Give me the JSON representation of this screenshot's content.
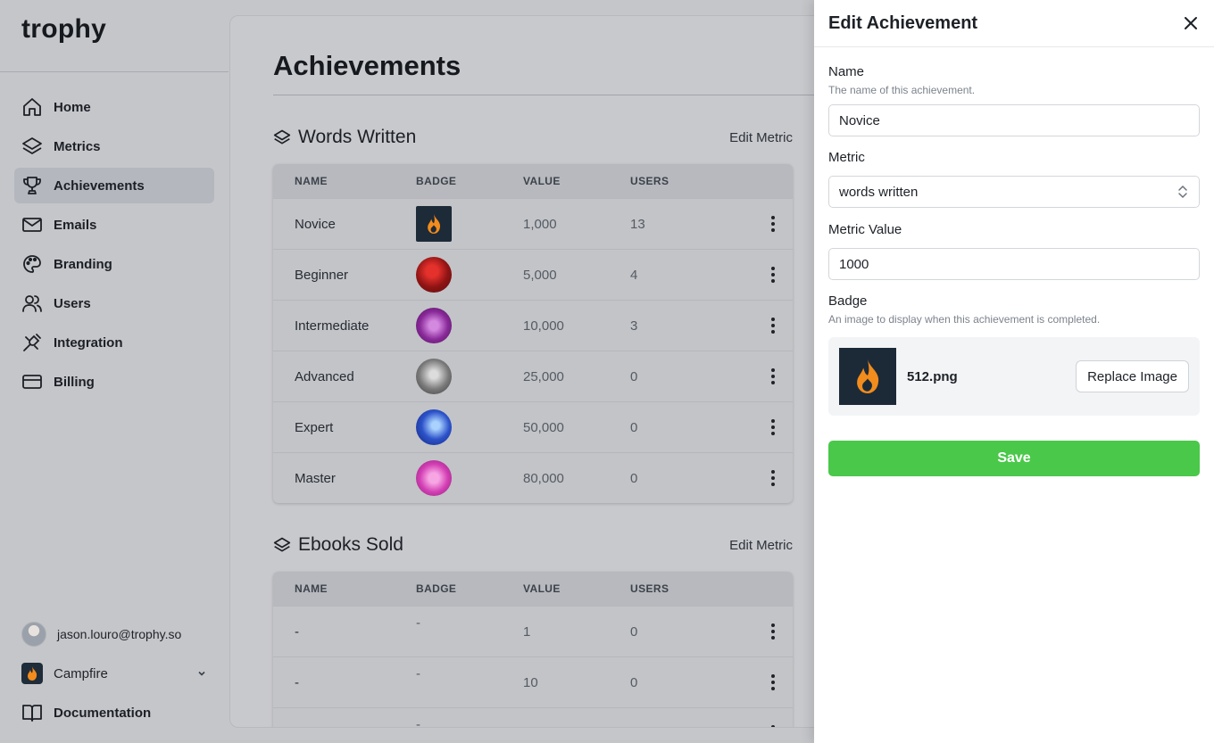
{
  "app": {
    "logo": "trophy"
  },
  "sidebar": {
    "items": [
      {
        "label": "Home",
        "icon": "home-icon"
      },
      {
        "label": "Metrics",
        "icon": "layers-icon"
      },
      {
        "label": "Achievements",
        "icon": "trophy-icon",
        "active": true
      },
      {
        "label": "Emails",
        "icon": "mail-icon"
      },
      {
        "label": "Branding",
        "icon": "palette-icon"
      },
      {
        "label": "Users",
        "icon": "users-icon"
      },
      {
        "label": "Integration",
        "icon": "plug-icon"
      },
      {
        "label": "Billing",
        "icon": "credit-card-icon"
      }
    ],
    "account_email": "jason.louro@trophy.so",
    "org_name": "Campfire",
    "docs_label": "Documentation"
  },
  "main": {
    "title": "Achievements",
    "sections": [
      {
        "title": "Words Written",
        "edit_label": "Edit Metric",
        "columns": [
          "NAME",
          "BADGE",
          "VALUE",
          "USERS"
        ],
        "rows": [
          {
            "name": "Novice",
            "badge": "flame-logo",
            "value": "1,000",
            "users": "13"
          },
          {
            "name": "Beginner",
            "badge": "red-photo",
            "value": "5,000",
            "users": "4"
          },
          {
            "name": "Intermediate",
            "badge": "purple-photo",
            "value": "10,000",
            "users": "3"
          },
          {
            "name": "Advanced",
            "badge": "gray-photo",
            "value": "25,000",
            "users": "0"
          },
          {
            "name": "Expert",
            "badge": "blue-photo",
            "value": "50,000",
            "users": "0"
          },
          {
            "name": "Master",
            "badge": "pink-photo",
            "value": "80,000",
            "users": "0"
          }
        ]
      },
      {
        "title": "Ebooks Sold",
        "edit_label": "Edit Metric",
        "columns": [
          "NAME",
          "BADGE",
          "VALUE",
          "USERS"
        ],
        "rows": [
          {
            "name": "-",
            "badge": "-",
            "value": "1",
            "users": "0"
          },
          {
            "name": "-",
            "badge": "-",
            "value": "10",
            "users": "0"
          },
          {
            "name": "",
            "badge": "-",
            "value": "",
            "users": ""
          }
        ]
      }
    ]
  },
  "drawer": {
    "title": "Edit Achievement",
    "name_label": "Name",
    "name_help": "The name of this achievement.",
    "name_value": "Novice",
    "metric_label": "Metric",
    "metric_value": "words written",
    "metric_value_label": "Metric Value",
    "metric_value_value": "1000",
    "badge_label": "Badge",
    "badge_help": "An image to display when this achievement is completed.",
    "badge_file": "512.png",
    "replace_label": "Replace Image",
    "save_label": "Save"
  },
  "colors": {
    "save_green": "#4ac84a",
    "flame_orange": "#f28c1c",
    "badge_bg": "#1c2a38"
  }
}
